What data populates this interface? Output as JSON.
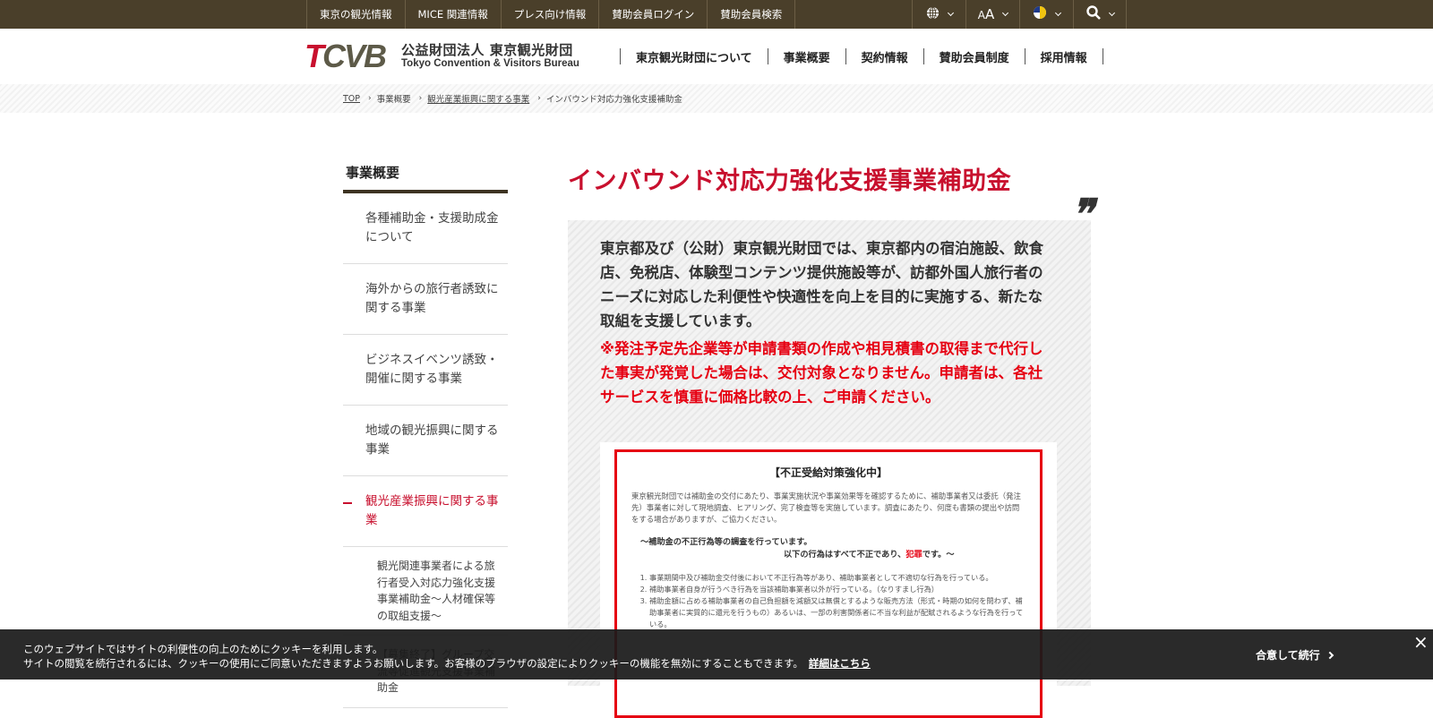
{
  "topbar": {
    "links": [
      "東京の観光情報",
      "MICE 関連情報",
      "プレス向け情報",
      "賛助会員ログイン",
      "賛助会員検索"
    ],
    "tools": {
      "language_icon": "globe-icon",
      "fontsize_label": "AA",
      "color_icon": "color-scheme-icon",
      "search_icon": "search-icon"
    }
  },
  "header": {
    "logo_mark_t": "T",
    "logo_mark_rest": "CVB",
    "org_name_jp": "公益財団法人 東京観光財団",
    "org_name_en": "Tokyo Convention & Visitors Bureau",
    "nav": [
      "東京観光財団について",
      "事業概要",
      "契約情報",
      "賛助会員制度",
      "採用情報"
    ]
  },
  "breadcrumb": {
    "items": [
      "TOP",
      "事業概要",
      "観光産業振興に関する事業",
      "インバウンド対応力強化支援補助金"
    ]
  },
  "sidenav": {
    "heading": "事業概要",
    "items": [
      "各種補助金・支援助成金について",
      "海外からの旅行者誘致に関する事業",
      "ビジネスイベンツ誘致・開催に関する事業",
      "地域の観光振興に関する事業",
      "観光産業振興に関する事業"
    ],
    "subitems": [
      "観光関連事業者による旅行者受入対応力強化支援事業補助金～人材確保等の取組支援～",
      "【募集終了】グループ交流等促進観光支援事業補助金"
    ]
  },
  "main": {
    "title": "インバウンド対応力強化支援事業補助金",
    "lead": "東京都及び（公財）東京観光財団では、東京都内の宿泊施設、飲食店、免税店、体験型コンテンツ提供施設等が、訪都外国人旅行者のニーズに対応した利便性や快適性を向上を目的に実施する、新たな取組を支援しています。",
    "warning": "※発注予定先企業等が申請書類の作成や相見積書の取得まで代行した事実が発覚した場合は、交付対象となりません。申請者は、各社サービスを慎重に価格比較の上、ご申請ください。",
    "notice": {
      "heading": "【不正受給対策強化中】",
      "intro": "東京観光財団では補助金の交付にあたり、事業実施状況や事業効果等を確認するために、補助事業者又は委託（発注先）事業者に対して現地調査、ヒアリング、完了検査等を実施しています。調査にあたり、何度も書類の提出や訪問をする場合がありますが、ご協力ください。",
      "subheading1": "～補助金の不正行為等の調査を行っています。",
      "subheading2_pre": "以下の行為はすべて不正であり、",
      "subheading2_crime": "犯罪",
      "subheading2_post": "です。～",
      "list": [
        "事業期間中及び補助金交付後において不正行為等があり、補助事業者として不適切な行為を行っている。",
        "補助事業者自身が行うべき行為を当該補助事業者以外が行っている。（なりすまし行為）",
        "補助金額に占める補助事業者の自己負担額を減額又は無償とするような販売方法（形式・時期の如何を問わず、補助事業者に実質的に還元を行うもの）あるいは、一部の利害関係者に不当な利益が配賦されるような行為を行っている。"
      ]
    }
  },
  "cookie": {
    "line1": "このウェブサイトではサイトの利便性の向上のためにクッキーを利用します。",
    "line2": "サイトの閲覧を続行されるには、クッキーの使用にご同意いただきますようお願いします。お客様のブラウザの設定によりクッキーの機能を無効にすることもできます。",
    "detail_link": "詳細はこちら",
    "agree": "合意して続行",
    "close": "×"
  },
  "colors": {
    "topbar": "#4a3f2a",
    "accent_red": "#c8102e",
    "warning_red": "#e60012"
  }
}
